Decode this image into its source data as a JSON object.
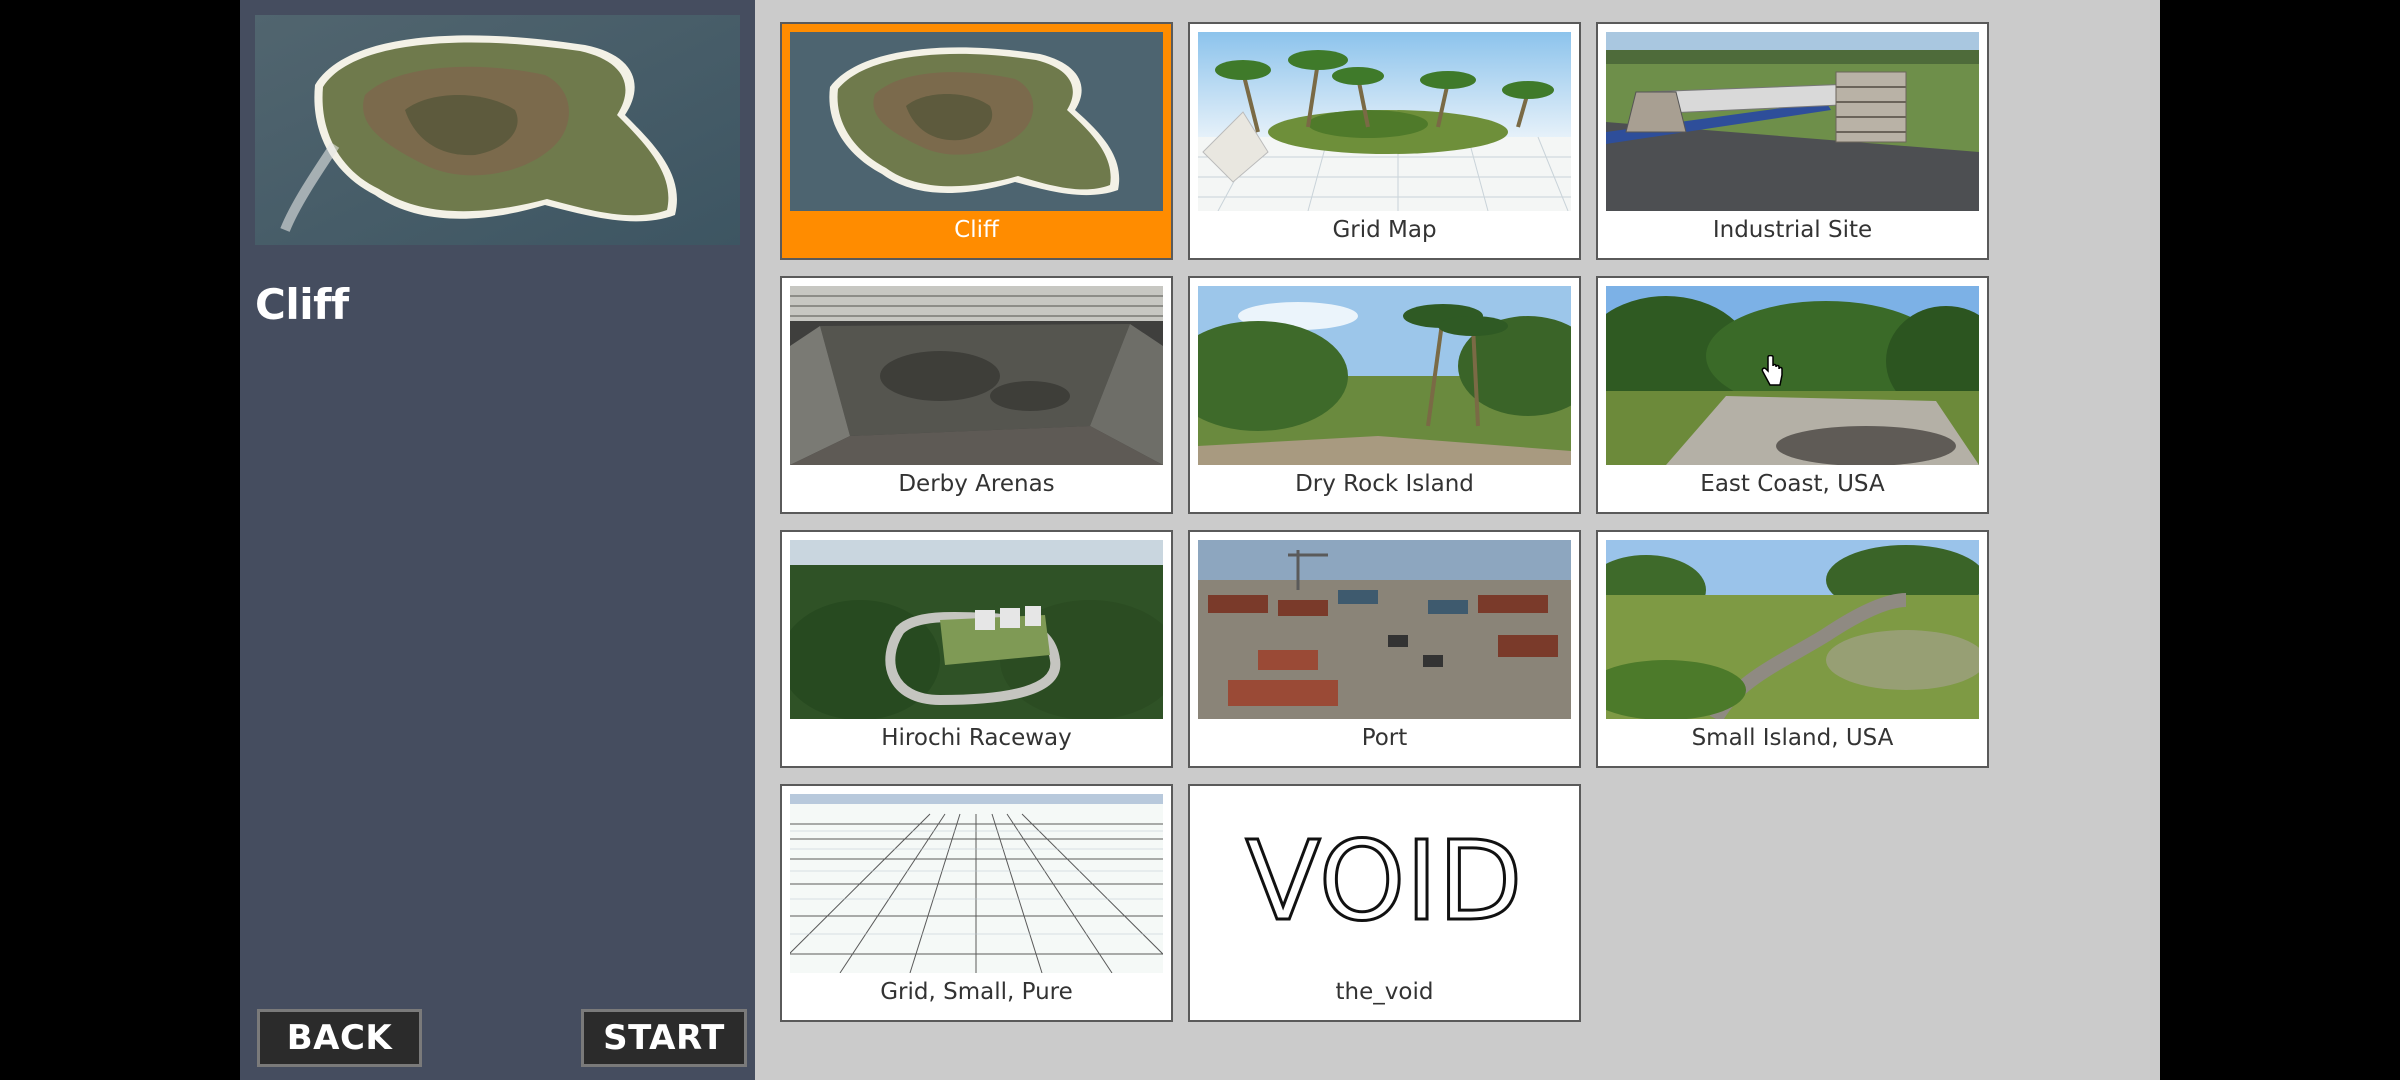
{
  "sidebar": {
    "title": "Cliff",
    "back_label": "BACK",
    "start_label": "START"
  },
  "maps": [
    {
      "name": "Cliff",
      "selected": true
    },
    {
      "name": "Grid Map",
      "selected": false
    },
    {
      "name": "Industrial Site",
      "selected": false
    },
    {
      "name": "Derby Arenas",
      "selected": false
    },
    {
      "name": "Dry Rock Island",
      "selected": false
    },
    {
      "name": "East Coast, USA",
      "selected": false
    },
    {
      "name": "Hirochi Raceway",
      "selected": false
    },
    {
      "name": "Port",
      "selected": false
    },
    {
      "name": "Small Island, USA",
      "selected": false
    },
    {
      "name": "Grid, Small, Pure",
      "selected": false
    },
    {
      "name": "the_void",
      "selected": false
    }
  ],
  "void_thumbnail_text": "VOID",
  "colors": {
    "selected": "#ff8c00",
    "sidebar": "#454d5f",
    "background": "#cbcbcb"
  }
}
